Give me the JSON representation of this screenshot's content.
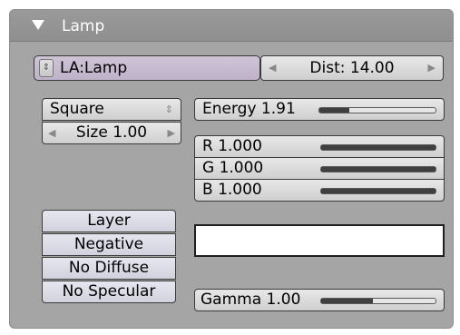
{
  "panel": {
    "title": "Lamp",
    "lamp_menu": {
      "label": "LA:Lamp"
    },
    "dist": {
      "label": "Dist: 14.00"
    },
    "shape_select": {
      "value": "Square"
    },
    "size": {
      "label": "Size 1.00"
    },
    "energy": {
      "label": "Energy 1.91",
      "level": 0.26
    },
    "r": {
      "label": "R 1.000",
      "level": 1.0
    },
    "g": {
      "label": "G 1.000",
      "level": 1.0
    },
    "b": {
      "label": "B 1.000",
      "level": 1.0
    },
    "color_preview": "#ffffff",
    "toggles": [
      "Layer",
      "Negative",
      "No Diffuse",
      "No Specular"
    ],
    "gamma": {
      "label": "Gamma 1.00",
      "level": 0.45
    }
  }
}
